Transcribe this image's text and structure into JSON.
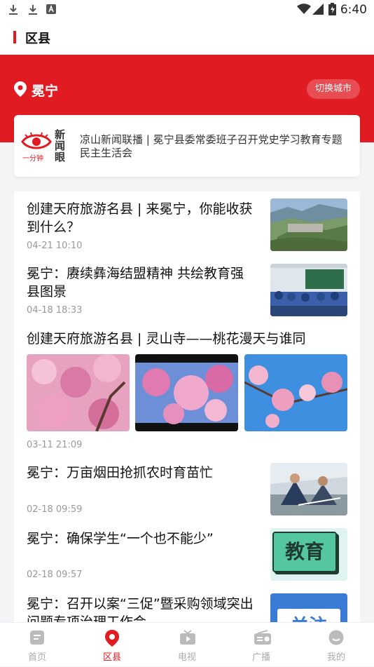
{
  "status_bar": {
    "time": "6:40"
  },
  "header": {
    "title": "区县"
  },
  "location": {
    "name": "冕宁",
    "switch_label": "切换城市"
  },
  "news_banner": {
    "logo_text_1": "新",
    "logo_text_2": "闻",
    "logo_text_3": "眼",
    "logo_sub": "一分钟",
    "text": "凉山新闻联播 | 冕宁县委常委班子召开党史学习教育专题民主生活会"
  },
  "articles": [
    {
      "title": "创建天府旅游名县 | 来冕宁，你能收获到什么？",
      "time": "04-21 10:10",
      "image": "city-valley-aerial"
    },
    {
      "title": "冕宁：赓续彝海结盟精神  共绘教育强县图景",
      "time": "04-18 18:33",
      "image": "classroom-students"
    },
    {
      "title": "创建天府旅游名县 | 灵山寺——桃花漫天与谁同",
      "time": "03-11 21:09",
      "images": [
        "peach-blossom-1",
        "peach-blossom-2",
        "peach-blossom-3"
      ]
    },
    {
      "title": "冕宁：万亩烟田抢抓农时育苗忙",
      "time": "02-18 09:59",
      "image": "farmers-greenhouse"
    },
    {
      "title": "冕宁：确保学生“一个也不能少”",
      "time": "02-18 09:57",
      "image": "education-banner",
      "image_text": "教育"
    },
    {
      "title": "冕宁：召开以案“三促”暨采购领域突出问题专项治理工作会",
      "time": "",
      "image": "attention-banner",
      "image_text": "关注"
    }
  ],
  "tabs": [
    {
      "label": "首页",
      "icon": "home-icon",
      "active": false
    },
    {
      "label": "区县",
      "icon": "location-pin-icon",
      "active": true
    },
    {
      "label": "电视",
      "icon": "tv-icon",
      "active": false
    },
    {
      "label": "广播",
      "icon": "radio-icon",
      "active": false
    },
    {
      "label": "我的",
      "icon": "user-icon",
      "active": false
    }
  ],
  "colors": {
    "brand_red": "#e11b22",
    "inactive_tab": "#aaaaaa"
  }
}
